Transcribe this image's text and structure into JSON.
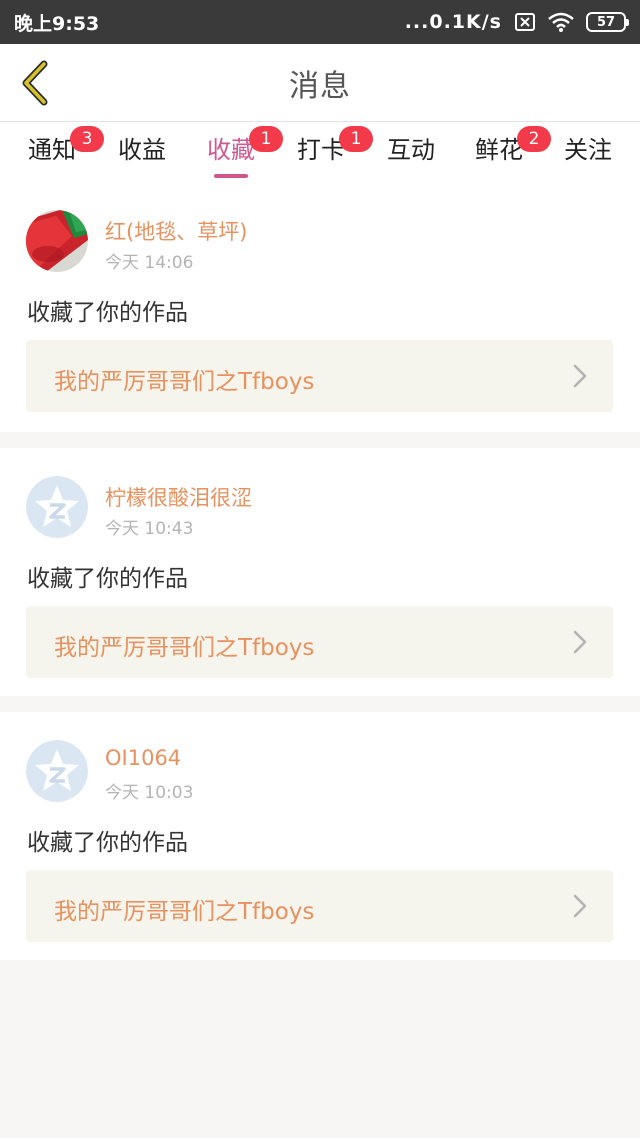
{
  "status_bar": {
    "time": "晚上9:53",
    "network_speed": "...0.1K/s",
    "battery": "57",
    "icons": [
      "sim-off-icon",
      "wifi-icon",
      "battery-icon"
    ]
  },
  "header": {
    "title": "消息",
    "back_icon": "chevron-left-icon"
  },
  "tabs": [
    {
      "label": "通知",
      "badge": "3",
      "active": false
    },
    {
      "label": "收益",
      "badge": "",
      "active": false
    },
    {
      "label": "收藏",
      "badge": "1",
      "active": true
    },
    {
      "label": "打卡",
      "badge": "1",
      "active": false
    },
    {
      "label": "互动",
      "badge": "",
      "active": false
    },
    {
      "label": "鲜花",
      "badge": "2",
      "active": false
    },
    {
      "label": "关注",
      "badge": "",
      "active": false
    }
  ],
  "messages": [
    {
      "user": "红(地毯、草坪)",
      "time": "今天 14:06",
      "action": "收藏了你的作品",
      "work_title": "我的严厉哥哥们之Tfboys",
      "avatar": "red-carpet-photo"
    },
    {
      "user": "柠檬很酸泪很涩",
      "time": "今天 10:43",
      "action": "收藏了你的作品",
      "work_title": "我的严厉哥哥们之Tfboys",
      "avatar": "default-qzone-avatar"
    },
    {
      "user": "OI1064",
      "time": "今天 10:03",
      "action": "收藏了你的作品",
      "work_title": "我的严厉哥哥们之Tfboys",
      "avatar": "default-qzone-avatar"
    }
  ],
  "colors": {
    "accent_pink": "#d0578f",
    "badge_red": "#f23a4a",
    "name_orange": "#e8915e",
    "back_icon_yellow": "#d7c22a"
  }
}
